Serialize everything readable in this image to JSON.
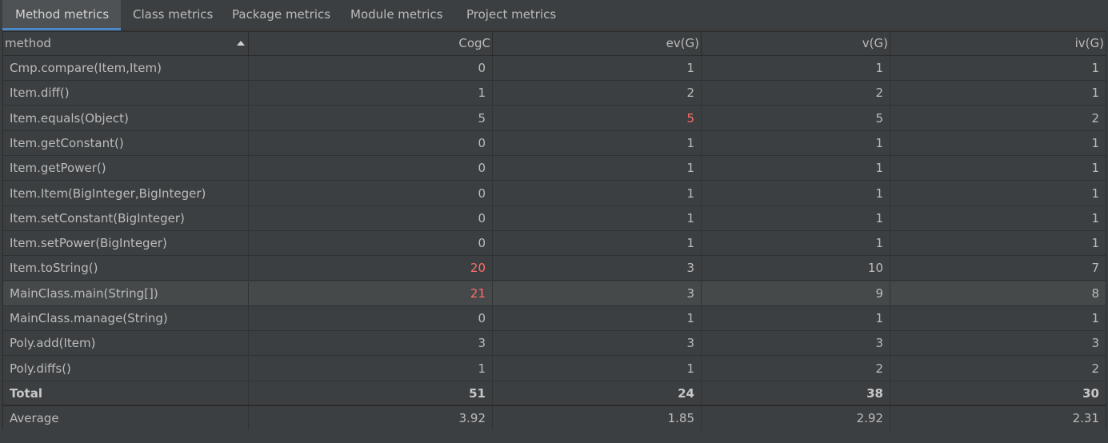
{
  "tabs": [
    {
      "label": "Method metrics",
      "active": true
    },
    {
      "label": "Class metrics",
      "active": false
    },
    {
      "label": "Package metrics",
      "active": false
    },
    {
      "label": "Module metrics",
      "active": false
    },
    {
      "label": "Project metrics",
      "active": false
    }
  ],
  "table": {
    "columns": [
      "method",
      "CogC",
      "ev(G)",
      "v(G)",
      "iv(G)"
    ],
    "sort": {
      "column": "method",
      "direction": "ascending"
    },
    "rows": [
      {
        "method": "Cmp.compare(Item,Item)",
        "CogC": "0",
        "ev": "1",
        "v": "1",
        "iv": "1"
      },
      {
        "method": "Item.diff()",
        "CogC": "1",
        "ev": "2",
        "v": "2",
        "iv": "1"
      },
      {
        "method": "Item.equals(Object)",
        "CogC": "5",
        "ev": "5",
        "v": "5",
        "iv": "2",
        "warn": [
          "ev"
        ]
      },
      {
        "method": "Item.getConstant()",
        "CogC": "0",
        "ev": "1",
        "v": "1",
        "iv": "1"
      },
      {
        "method": "Item.getPower()",
        "CogC": "0",
        "ev": "1",
        "v": "1",
        "iv": "1"
      },
      {
        "method": "Item.Item(BigInteger,BigInteger)",
        "CogC": "0",
        "ev": "1",
        "v": "1",
        "iv": "1"
      },
      {
        "method": "Item.setConstant(BigInteger)",
        "CogC": "0",
        "ev": "1",
        "v": "1",
        "iv": "1"
      },
      {
        "method": "Item.setPower(BigInteger)",
        "CogC": "0",
        "ev": "1",
        "v": "1",
        "iv": "1"
      },
      {
        "method": "Item.toString()",
        "CogC": "20",
        "ev": "3",
        "v": "10",
        "iv": "7",
        "warn": [
          "CogC"
        ]
      },
      {
        "method": "MainClass.main(String[])",
        "CogC": "21",
        "ev": "3",
        "v": "9",
        "iv": "8",
        "warn": [
          "CogC"
        ],
        "selected": true
      },
      {
        "method": "MainClass.manage(String)",
        "CogC": "0",
        "ev": "1",
        "v": "1",
        "iv": "1"
      },
      {
        "method": "Poly.add(Item)",
        "CogC": "3",
        "ev": "3",
        "v": "3",
        "iv": "3"
      },
      {
        "method": "Poly.diffs()",
        "CogC": "1",
        "ev": "1",
        "v": "2",
        "iv": "2"
      }
    ],
    "total": {
      "method": "Total",
      "CogC": "51",
      "ev": "24",
      "v": "38",
      "iv": "30"
    },
    "average": {
      "method": "Average",
      "CogC": "3.92",
      "ev": "1.85",
      "v": "2.92",
      "iv": "2.31"
    }
  },
  "colors": {
    "background": "#3c3f41",
    "text": "#bbbbbb",
    "warning": "#ff6b68",
    "active_tab_underline": "#4a88c7",
    "selected_row": "#45494a"
  }
}
